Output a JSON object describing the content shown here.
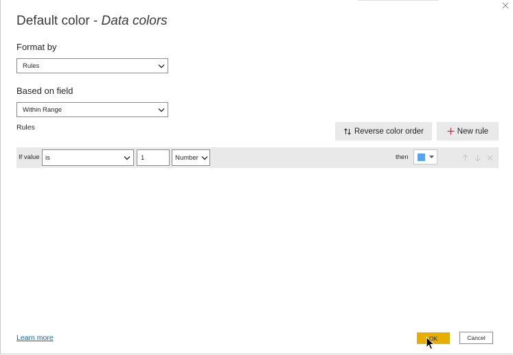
{
  "dialog": {
    "title_main": "Default color - ",
    "title_italic": "Data colors"
  },
  "format_by": {
    "label": "Format by",
    "selected": "Rules"
  },
  "based_on": {
    "label": "Based on field",
    "selected": "Within Range"
  },
  "rules": {
    "label": "Rules",
    "reverse_label": "Reverse color order",
    "new_rule_label": "New rule"
  },
  "rule_row": {
    "if_value_label": "If value",
    "operator": "is",
    "value": "1",
    "type": "Number",
    "then_label": "then",
    "color": "#5aa3e8"
  },
  "footer": {
    "learn_more": "Learn more",
    "ok_label": "OK",
    "cancel_label": "Cancel"
  },
  "colors": {
    "accent": "#e5ae00",
    "link": "#0064b5",
    "row_bg": "#e9e9e9"
  }
}
